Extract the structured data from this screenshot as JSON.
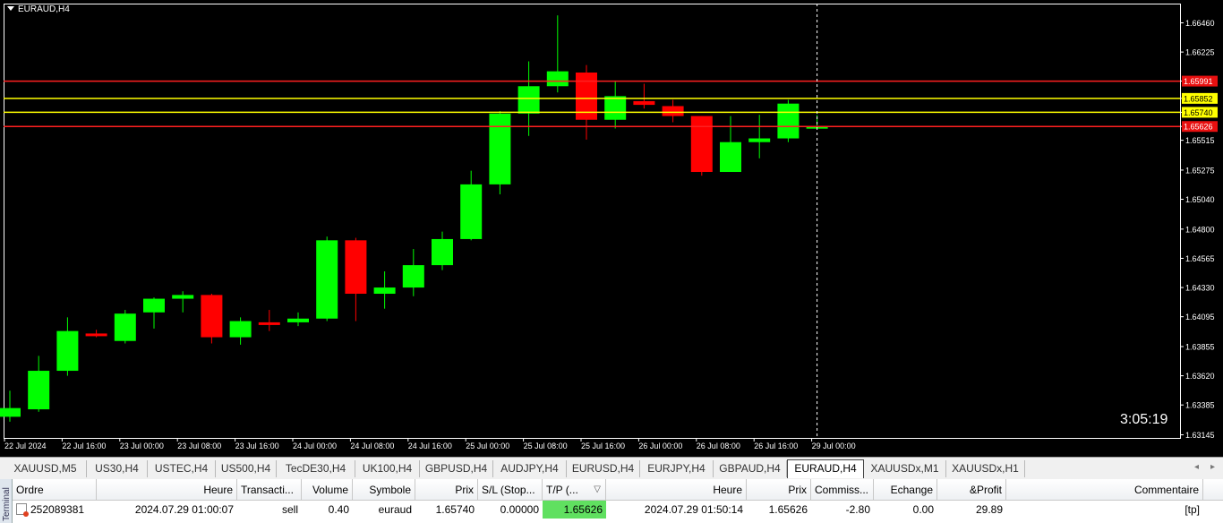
{
  "chart": {
    "title": "EURAUD,H4",
    "timer": "3:05:19",
    "colors": {
      "bull": "#00ff00",
      "bear": "#ff0000",
      "level_red": "#ff2020",
      "level_yellow": "#ffff00"
    }
  },
  "chart_data": {
    "type": "candlestick",
    "ylim": [
      1.6312,
      1.6661
    ],
    "y_ticks": [
      "1.66460",
      "1.66225",
      "1.65991",
      "1.65852",
      "1.65740",
      "1.65626",
      "1.65515",
      "1.65275",
      "1.65040",
      "1.64800",
      "1.64565",
      "1.64330",
      "1.64095",
      "1.63855",
      "1.63620",
      "1.63385",
      "1.63145"
    ],
    "x_ticks": [
      "22 Jul 2024",
      "22 Jul 16:00",
      "23 Jul 00:00",
      "23 Jul 08:00",
      "23 Jul 16:00",
      "24 Jul 00:00",
      "24 Jul 08:00",
      "24 Jul 16:00",
      "25 Jul 00:00",
      "25 Jul 08:00",
      "25 Jul 16:00",
      "26 Jul 00:00",
      "26 Jul 08:00",
      "26 Jul 16:00",
      "29 Jul 00:00"
    ],
    "candles": [
      {
        "o": 1.6329,
        "h": 1.635,
        "l": 1.6325,
        "c": 1.6336
      },
      {
        "o": 1.6335,
        "h": 1.6378,
        "l": 1.6333,
        "c": 1.6366
      },
      {
        "o": 1.6366,
        "h": 1.6409,
        "l": 1.6362,
        "c": 1.6398
      },
      {
        "o": 1.6396,
        "h": 1.6399,
        "l": 1.6393,
        "c": 1.6395
      },
      {
        "o": 1.639,
        "h": 1.6415,
        "l": 1.6388,
        "c": 1.6412
      },
      {
        "o": 1.6413,
        "h": 1.6425,
        "l": 1.64,
        "c": 1.6424
      },
      {
        "o": 1.6424,
        "h": 1.643,
        "l": 1.6413,
        "c": 1.6427
      },
      {
        "o": 1.6427,
        "h": 1.6428,
        "l": 1.6388,
        "c": 1.6393
      },
      {
        "o": 1.6393,
        "h": 1.6409,
        "l": 1.6387,
        "c": 1.6406
      },
      {
        "o": 1.6405,
        "h": 1.6415,
        "l": 1.6398,
        "c": 1.6403
      },
      {
        "o": 1.6405,
        "h": 1.6413,
        "l": 1.6402,
        "c": 1.6408
      },
      {
        "o": 1.6408,
        "h": 1.6474,
        "l": 1.6406,
        "c": 1.6471
      },
      {
        "o": 1.6471,
        "h": 1.6473,
        "l": 1.6406,
        "c": 1.6428
      },
      {
        "o": 1.6428,
        "h": 1.6446,
        "l": 1.6416,
        "c": 1.6433
      },
      {
        "o": 1.6433,
        "h": 1.6464,
        "l": 1.6426,
        "c": 1.6451
      },
      {
        "o": 1.6451,
        "h": 1.6478,
        "l": 1.6447,
        "c": 1.6472
      },
      {
        "o": 1.6472,
        "h": 1.6527,
        "l": 1.6471,
        "c": 1.6516
      },
      {
        "o": 1.6516,
        "h": 1.6575,
        "l": 1.6508,
        "c": 1.6573
      },
      {
        "o": 1.6573,
        "h": 1.6615,
        "l": 1.6555,
        "c": 1.6595
      },
      {
        "o": 1.6595,
        "h": 1.6652,
        "l": 1.659,
        "c": 1.6607
      },
      {
        "o": 1.6606,
        "h": 1.6612,
        "l": 1.6552,
        "c": 1.6568
      },
      {
        "o": 1.6568,
        "h": 1.6599,
        "l": 1.6561,
        "c": 1.6587
      },
      {
        "o": 1.6583,
        "h": 1.6597,
        "l": 1.6577,
        "c": 1.658
      },
      {
        "o": 1.6579,
        "h": 1.6584,
        "l": 1.6566,
        "c": 1.6571
      },
      {
        "o": 1.6571,
        "h": 1.6571,
        "l": 1.6523,
        "c": 1.6526
      },
      {
        "o": 1.6526,
        "h": 1.6571,
        "l": 1.6526,
        "c": 1.655
      },
      {
        "o": 1.655,
        "h": 1.6572,
        "l": 1.6537,
        "c": 1.6553
      },
      {
        "o": 1.6553,
        "h": 1.6584,
        "l": 1.655,
        "c": 1.6581
      },
      {
        "o": 1.6563,
        "h": 1.6572,
        "l": 1.6561,
        "c": 1.6563
      }
    ],
    "levels": [
      {
        "value": "1.65991",
        "price": 1.65991,
        "color": "red"
      },
      {
        "value": "1.65852",
        "price": 1.65852,
        "color": "yellow"
      },
      {
        "value": "1.65740",
        "price": 1.6574,
        "color": "yellow"
      },
      {
        "value": "1.65626",
        "price": 1.65626,
        "color": "red"
      }
    ],
    "crosshair_candle_index": 28,
    "grid": false
  },
  "tabs": {
    "items": [
      {
        "label": "XAUUSD,M5"
      },
      {
        "label": "US30,H4"
      },
      {
        "label": "USTEC,H4"
      },
      {
        "label": "US500,H4"
      },
      {
        "label": "TecDE30,H4"
      },
      {
        "label": "UK100,H4"
      },
      {
        "label": "GBPUSD,H4"
      },
      {
        "label": "AUDJPY,H4"
      },
      {
        "label": "EURUSD,H4"
      },
      {
        "label": "EURJPY,H4"
      },
      {
        "label": "GBPAUD,H4"
      },
      {
        "label": "EURAUD,H4",
        "active": true
      },
      {
        "label": "XAUUSDx,M1"
      },
      {
        "label": "XAUUSDx,H1"
      }
    ],
    "left_arrow": "◂",
    "right_arrow": "▸"
  },
  "terminal": {
    "side_label": "Terminal",
    "headers": {
      "ordre": "Ordre",
      "heure": "Heure",
      "transaction": "Transacti...",
      "volume": "Volume",
      "symbole": "Symbole",
      "prix": "Prix",
      "sl": "S/L (Stop...",
      "tp": "T/P (...",
      "sort_icon": "▽",
      "heure2": "Heure",
      "prix2": "Prix",
      "commission": "Commiss...",
      "echange": "Echange",
      "profit": "&Profit",
      "commentaire": "Commentaire"
    },
    "row": {
      "ordre": "252089381",
      "heure": "2024.07.29 01:00:07",
      "transaction": "sell",
      "volume": "0.40",
      "symbole": "euraud",
      "prix": "1.65740",
      "sl": "0.00000",
      "tp": "1.65626",
      "heure2": "2024.07.29 01:50:14",
      "prix2": "1.65626",
      "commission": "-2.80",
      "echange": "0.00",
      "profit": "29.89",
      "commentaire": "[tp]"
    }
  }
}
